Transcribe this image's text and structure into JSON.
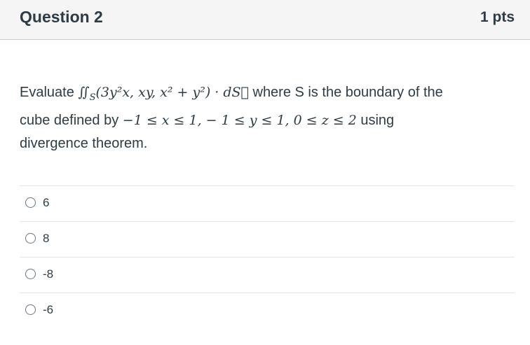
{
  "header": {
    "title": "Question 2",
    "points": "1 pts"
  },
  "question": {
    "line1_prefix": "Evaluate ",
    "integral": "∬",
    "integral_sub": "S",
    "vector_field": "(3y²x, xy, x² + y²) · dS⃗",
    "line1_suffix": " where S is the boundary of the",
    "line2_prefix": "cube defined by ",
    "bounds": "−1 ≤ x ≤ 1,  − 1 ≤ y ≤ 1, 0 ≤ z ≤ 2",
    "line2_suffix": " using",
    "line3": "divergence theorem."
  },
  "answers": [
    {
      "label": "6"
    },
    {
      "label": "8"
    },
    {
      "label": "-8"
    },
    {
      "label": "-6"
    }
  ]
}
